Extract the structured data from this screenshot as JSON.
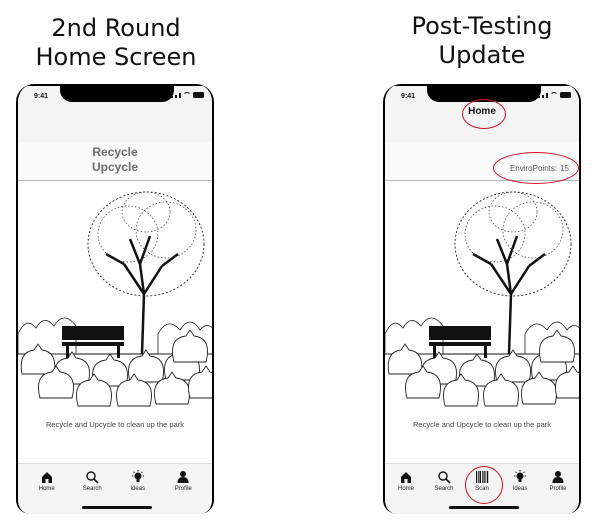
{
  "left": {
    "heading_line1": "2nd Round",
    "heading_line2": "Home Screen",
    "phone": {
      "time": "9:41",
      "title_line1": "Recycle",
      "title_line2": "Upcycle",
      "caption": "Recycle and Upcycle to clean up the park",
      "tabs": [
        {
          "label": "Home",
          "icon": "home-icon"
        },
        {
          "label": "Search",
          "icon": "search-icon"
        },
        {
          "label": "Ideas",
          "icon": "lightbulb-icon"
        },
        {
          "label": "Profile",
          "icon": "person-icon"
        }
      ]
    }
  },
  "right": {
    "heading_line1": "Post-Testing",
    "heading_line2": "Update",
    "phone": {
      "time": "9:41",
      "top_title": "Home",
      "points_label": "EnviroPoints:",
      "points_value": "15",
      "caption": "Recycle and Upcycle to clean up the park",
      "tabs": [
        {
          "label": "Home",
          "icon": "home-icon"
        },
        {
          "label": "Search",
          "icon": "search-icon"
        },
        {
          "label": "Scan",
          "icon": "barcode-icon"
        },
        {
          "label": "Ideas",
          "icon": "lightbulb-icon"
        },
        {
          "label": "Profile",
          "icon": "person-icon"
        }
      ]
    }
  },
  "colors": {
    "annotation": "#d0131e",
    "muted_title": "#6b6b6b"
  }
}
